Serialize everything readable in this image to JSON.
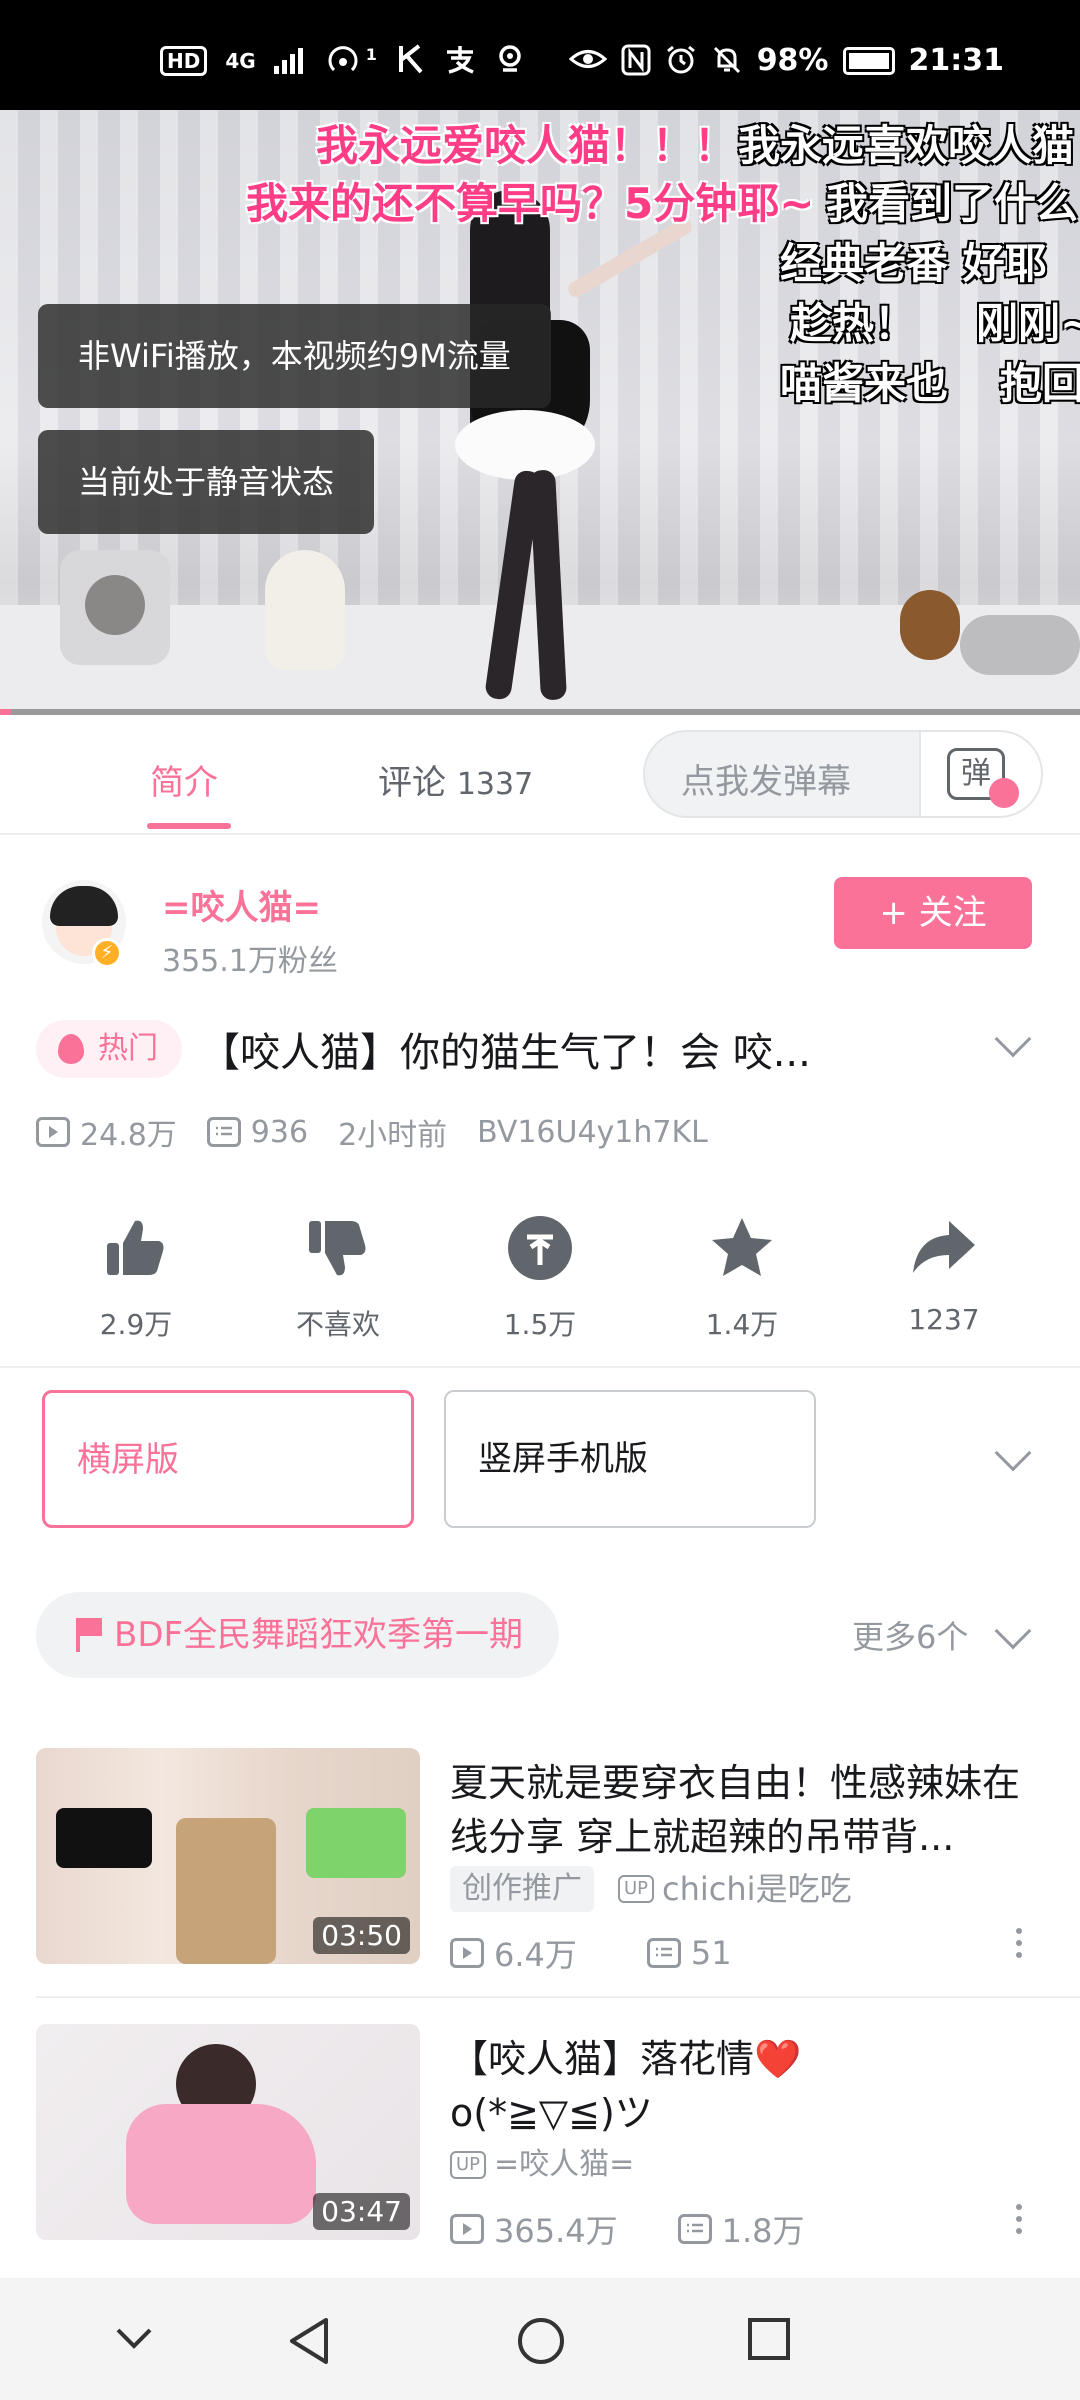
{
  "status_bar": {
    "hd": "HD",
    "net": "4G",
    "signal_sup": "1",
    "battery": "98%",
    "time": "21:31"
  },
  "video": {
    "danmaku": [
      "我永远爱咬人猫！！！",
      "我永远喜欢咬人猫",
      "我来的还不算早吗？5分钟耶~",
      "我看到了什么",
      "经典老番 好耶",
      "趁热！",
      "刚刚~",
      "喵酱来也",
      "抱回"
    ],
    "toast_data": "非WiFi播放，本视频约9M流量",
    "toast_mute": "当前处于静音状态",
    "progress_fraction": 0.01
  },
  "tabs": {
    "intro": "简介",
    "comments": "评论",
    "comments_count": "1337",
    "danmaku_placeholder": "点我发弹幕",
    "danmaku_btn": "弹"
  },
  "uploader": {
    "name": "=咬人猫=",
    "fans": "355.1万粉丝",
    "follow": "+ 关注"
  },
  "video_info": {
    "hot_label": "热门",
    "title": "【咬人猫】你的猫生气了！会 咬...",
    "views": "24.8万",
    "danmaku_count": "936",
    "time": "2小时前",
    "bvid": "BV16U4y1h7KL"
  },
  "actions": [
    {
      "icon": "thumbs-up-icon",
      "label": "2.9万"
    },
    {
      "icon": "thumbs-down-icon",
      "label": "不喜欢"
    },
    {
      "icon": "coin-icon",
      "label": "1.5万"
    },
    {
      "icon": "star-icon",
      "label": "1.4万"
    },
    {
      "icon": "share-icon",
      "label": "1237"
    }
  ],
  "versions": {
    "landscape": "横屏版",
    "portrait": "竖屏手机版"
  },
  "series": {
    "name": "BDF全民舞蹈狂欢季第一期",
    "more": "更多6个"
  },
  "recommendations": [
    {
      "title": "夏天就是要穿衣自由！性感辣妹在线分享 穿上就超辣的吊带背...",
      "promo": "创作推广",
      "up_tag": "UP",
      "up": "chichi是吃吃",
      "views": "6.4万",
      "danmaku": "51",
      "duration": "03:50"
    },
    {
      "title": "【咬人猫】落花情❤️ o(*≧▽≦)ツ",
      "up_tag": "UP",
      "up": "=咬人猫=",
      "views": "365.4万",
      "danmaku": "1.8万",
      "duration": "03:47"
    }
  ],
  "colors": {
    "accent": "#fb7299",
    "text": "#18191c",
    "muted": "#9499a0"
  }
}
